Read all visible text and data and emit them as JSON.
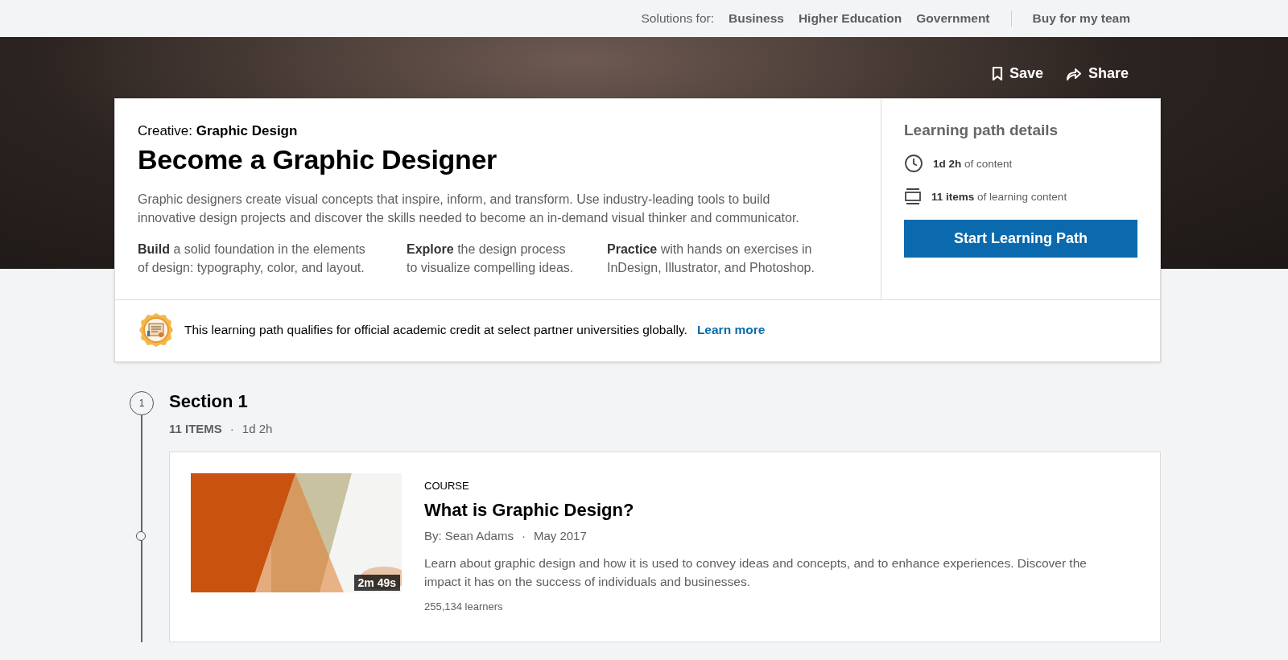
{
  "top_bar": {
    "label": "Solutions for:",
    "links": [
      "Business",
      "Higher Education",
      "Government"
    ],
    "cta": "Buy for my team"
  },
  "hero_actions": [
    {
      "kind": "save",
      "label": "Save"
    },
    {
      "kind": "share",
      "label": "Share"
    }
  ],
  "header": {
    "category": "Creative: **Graphic Design**",
    "title": "Become a Graphic Designer",
    "description": "Graphic designers create visual concepts that inspire, inform, and transform. Use industry-leading tools to build innovative design projects and discover the skills needed to become an in-demand visual thinker and communicator.",
    "highlights": [
      "**Build** a solid foundation in the elements of design: typography, color, and layout.",
      "**Explore** the design process to visualize compelling ideas.",
      "**Practice** with hands on exercises in InDesign, Illustrator, and Photoshop."
    ]
  },
  "details": {
    "title": "Learning path details",
    "items": [
      {
        "kind": "clock",
        "text": "**1d 2h** of content"
      },
      {
        "kind": "stack",
        "text": "**11 items** of learning content"
      }
    ],
    "button": "Start Learning Path"
  },
  "credit": {
    "text": "This learning path qualifies for official academic credit at select partner universities globally.",
    "link": "Learn more"
  },
  "sections": [
    {
      "number": "1",
      "title": "Section 1",
      "count": "11 ITEMS",
      "separator": "·",
      "duration": "1d 2h",
      "items": [
        {
          "type": "COURSE",
          "title": "What is Graphic Design?",
          "author": "By: Sean Adams",
          "separator": "·",
          "date": "May 2017",
          "description": "Learn about graphic design and how it is used to convey ideas and concepts, and to enhance experiences. Discover the impact it has on the success of individuals and businesses.",
          "duration": "2m 49s",
          "learners": "255,134 learners"
        }
      ]
    }
  ]
}
